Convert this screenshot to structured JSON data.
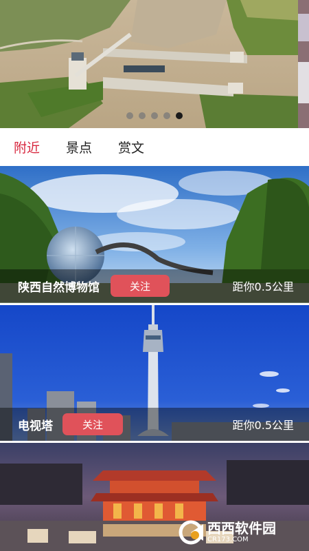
{
  "banner": {
    "slide_count": 5,
    "active_index": 4
  },
  "tabs": [
    {
      "label": "附近",
      "active": true
    },
    {
      "label": "景点",
      "active": false
    },
    {
      "label": "赏文",
      "active": false
    }
  ],
  "places": [
    {
      "name": "陕西自然博物馆",
      "follow_label": "关注",
      "distance": "距你0.5公里"
    },
    {
      "name": "电视塔",
      "follow_label": "关注",
      "distance": "距你0.5公里"
    }
  ],
  "watermark": {
    "brand": "西西软件园",
    "url": "CR173.COM"
  },
  "colors": {
    "accent": "#d7263d",
    "follow_button": "#e0525a"
  }
}
